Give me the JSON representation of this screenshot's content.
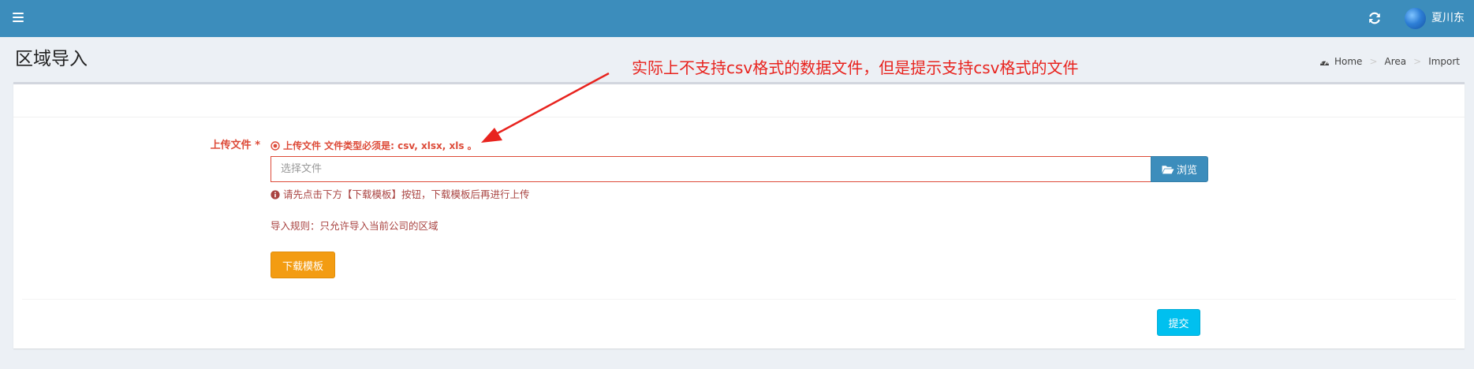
{
  "header": {
    "menu_icon": "hamburger-icon",
    "refresh_icon": "refresh-icon",
    "username": "夏川东"
  },
  "page": {
    "title": "区域导入"
  },
  "breadcrumb": {
    "icon": "dashboard-icon",
    "items": [
      "Home",
      "Area",
      "Import"
    ]
  },
  "annotation": {
    "text": "实际上不支持csv格式的数据文件，但是提示支持csv格式的文件",
    "color": "#e8231e"
  },
  "form": {
    "label": "上传文件 *",
    "error": "上传文件 文件类型必须是: csv, xlsx, xls 。",
    "file_placeholder": "选择文件",
    "browse_label": "浏览",
    "help": "请先点击下方【下载模板】按钮，下载模板后再进行上传",
    "rule": "导入规则：只允许导入当前公司的区域",
    "download_label": "下载模板",
    "submit_label": "提交"
  },
  "colors": {
    "topbar": "#3c8dbc",
    "error": "#dd4b39",
    "download_button": "#f39c12",
    "submit_button": "#00c0ef"
  }
}
